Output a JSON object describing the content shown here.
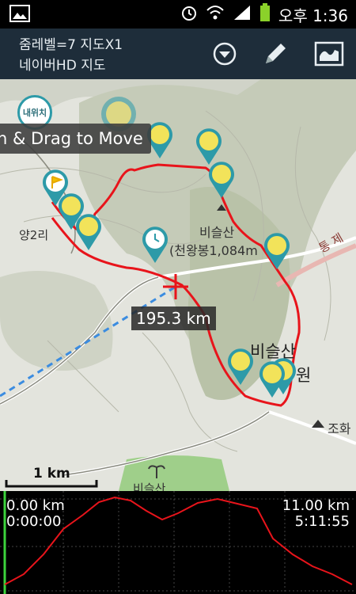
{
  "status": {
    "time": "오후 1:36"
  },
  "toolbar": {
    "zoom_line": "줌레벨=7 지도X1",
    "map_line": "네이버HD 지도",
    "icons": [
      "dropdown-icon",
      "pencil-icon",
      "map-icon"
    ]
  },
  "map": {
    "my_location_label": "내위치",
    "tooltip": "h & Drag to Move",
    "distance": "195.3 km",
    "scale": "1 km",
    "labels": {
      "yang2ri": "양2리",
      "bisulsan": "비슬산",
      "peak": "(천왕봉1,084m",
      "bisulsan_big": "비슬산",
      "won": "원",
      "road": "통 제",
      "joha": "조화",
      "bottom": "비슬산"
    }
  },
  "elevation": {
    "start_distance": "0.00 km",
    "start_time": "0:00:00",
    "end_distance": "11.00 km",
    "end_time": "5:11:55"
  },
  "colors": {
    "route": "#e8141b",
    "toolbar": "#1e2d3a",
    "marker": "#2d9aa8",
    "marker_inner": "#f2e35a"
  }
}
